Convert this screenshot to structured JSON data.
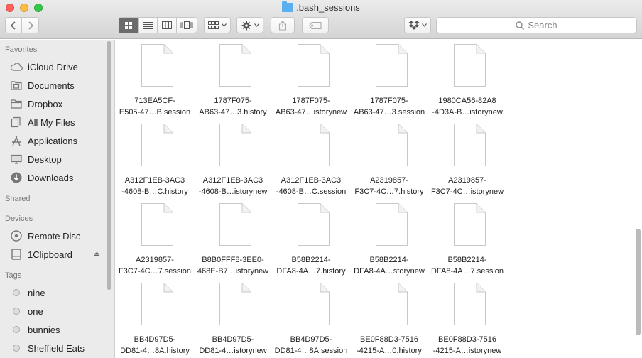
{
  "window": {
    "title": ".bash_sessions"
  },
  "toolbar": {
    "search_placeholder": "Search"
  },
  "sidebar": {
    "favorites_header": "Favorites",
    "favorites": [
      {
        "label": "iCloud Drive",
        "icon": "cloud-icon"
      },
      {
        "label": "Documents",
        "icon": "documents-icon"
      },
      {
        "label": "Dropbox",
        "icon": "folder-icon"
      },
      {
        "label": "All My Files",
        "icon": "all-files-icon"
      },
      {
        "label": "Applications",
        "icon": "applications-icon"
      },
      {
        "label": "Desktop",
        "icon": "desktop-icon"
      },
      {
        "label": "Downloads",
        "icon": "downloads-icon"
      }
    ],
    "shared_header": "Shared",
    "devices_header": "Devices",
    "devices": [
      {
        "label": "Remote Disc",
        "icon": "disc-icon"
      },
      {
        "label": "1Clipboard",
        "icon": "drive-icon"
      }
    ],
    "tags_header": "Tags",
    "tags": [
      {
        "label": "nine"
      },
      {
        "label": "one"
      },
      {
        "label": "bunnies"
      },
      {
        "label": "Sheffield Eats"
      }
    ]
  },
  "files": [
    {
      "line1": "713EA5CF-",
      "line2": "E505-47…B.session"
    },
    {
      "line1": "1787F075-",
      "line2": "AB63-47…3.history"
    },
    {
      "line1": "1787F075-",
      "line2": "AB63-47…istorynew"
    },
    {
      "line1": "1787F075-",
      "line2": "AB63-47…3.session"
    },
    {
      "line1": "1980CA56-82A8",
      "line2": "-4D3A-B…istorynew"
    },
    {
      "line1": "A312F1EB-3AC3",
      "line2": "-4608-B…C.history"
    },
    {
      "line1": "A312F1EB-3AC3",
      "line2": "-4608-B…istorynew"
    },
    {
      "line1": "A312F1EB-3AC3",
      "line2": "-4608-B…C.session"
    },
    {
      "line1": "A2319857-",
      "line2": "F3C7-4C…7.history"
    },
    {
      "line1": "A2319857-",
      "line2": "F3C7-4C…istorynew"
    },
    {
      "line1": "A2319857-",
      "line2": "F3C7-4C…7.session"
    },
    {
      "line1": "B8B0FFF8-3EE0-",
      "line2": "468E-B7…istorynew"
    },
    {
      "line1": "B58B2214-",
      "line2": "DFA8-4A…7.history"
    },
    {
      "line1": "B58B2214-",
      "line2": "DFA8-4A…storynew"
    },
    {
      "line1": "B58B2214-",
      "line2": "DFA8-4A…7.session"
    },
    {
      "line1": "BB4D97D5-",
      "line2": "DD81-4…8A.history"
    },
    {
      "line1": "BB4D97D5-",
      "line2": "DD81-4…istorynew"
    },
    {
      "line1": "BB4D97D5-",
      "line2": "DD81-4…8A.session"
    },
    {
      "line1": "BE0F88D3-7516",
      "line2": "-4215-A…0.history"
    },
    {
      "line1": "BE0F88D3-7516",
      "line2": "-4215-A…istorynew"
    }
  ]
}
